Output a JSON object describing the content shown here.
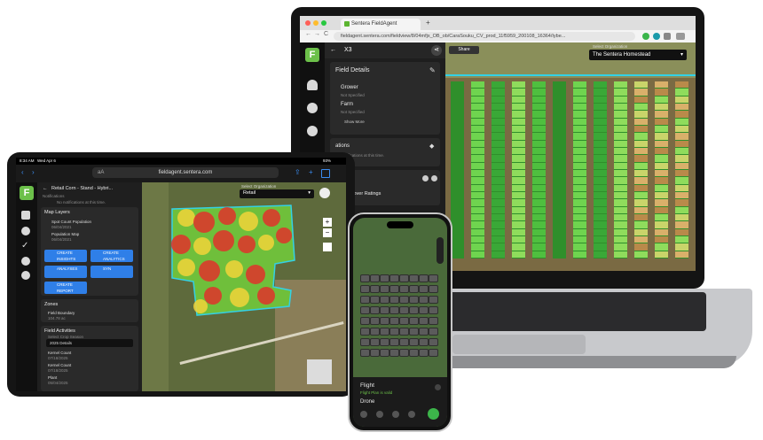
{
  "laptop": {
    "browser": {
      "tab_title": "Sentera FieldAgent",
      "url": "fieldagent.sentera.com/fieldview/8/04mfjx_OB_ob/CaraSouku_CV_prod_11f5959_200108_16364/Iybe...",
      "nav_back": "←",
      "nav_forward": "→",
      "reload": "C",
      "new_tab": "+"
    },
    "app": {
      "header_title": "X3",
      "header_back": "←",
      "share_label": "Share",
      "section_title": "Field Details",
      "grower_label": "Grower",
      "grower_value": "Not Specified",
      "farm_label": "Farm",
      "farm_value": "Not Specified",
      "show_more": "Show More",
      "notifications_label": "ations",
      "notifications_sub": "No notifications at this time.",
      "layers_label": "ayers",
      "layer_item": "anopy Cover Ratings",
      "org_select_label": "Select Organization",
      "org_name": "The Sentera Homestead"
    }
  },
  "tablet": {
    "status_time": "8:34 AM",
    "status_date": "Wed Apr 6",
    "status_battery": "93%",
    "url": "fieldagent.sentera.com",
    "url_prefix": "aA",
    "header_title": "Retail Corn - Stand - Hybri...",
    "header_back": "←",
    "notifications_label": "Notifications",
    "notifications_sub": "No notifications at this time.",
    "map_layers_title": "Map Layers",
    "layers": [
      {
        "label": "Spot Count Population",
        "date": "06/04/2021"
      },
      {
        "label": "Population Map",
        "date": "06/04/2021"
      }
    ],
    "buttons": [
      {
        "label": "CREATE INSIGHTS"
      },
      {
        "label": "CREATE ANALYTICS"
      },
      {
        "label": "ANALYSES"
      },
      {
        "label": "SYN"
      },
      {
        "label": "CREATE REPORT"
      }
    ],
    "zones_title": "Zones",
    "zones_item": "Field Boundary",
    "zones_item_sub": "104.78 ac",
    "field_activities_title": "Field Activities",
    "season_label": "Select Crop Season",
    "season_value": "2025 Details",
    "activities": [
      {
        "label": "Kernel Count",
        "date": "07/18/2025"
      },
      {
        "label": "Kernel Count",
        "date": "07/18/2025"
      },
      {
        "label": "Plant",
        "date": "05/04/2025"
      }
    ],
    "org_label": "Select Organization",
    "org_value": "Retail",
    "zoom_in": "+",
    "zoom_out": "−"
  },
  "phone": {
    "card_title": "Flight",
    "card_sub": "Flight Plan is valid",
    "device_label": "Drone"
  },
  "colors": {
    "brand_green": "#6cc04a",
    "accent_blue": "#2f7fe8",
    "heat_red": "#e0312b",
    "heat_yellow": "#f2d43a",
    "heat_green": "#6fbf3b",
    "boundary_cyan": "#33d1e6"
  }
}
